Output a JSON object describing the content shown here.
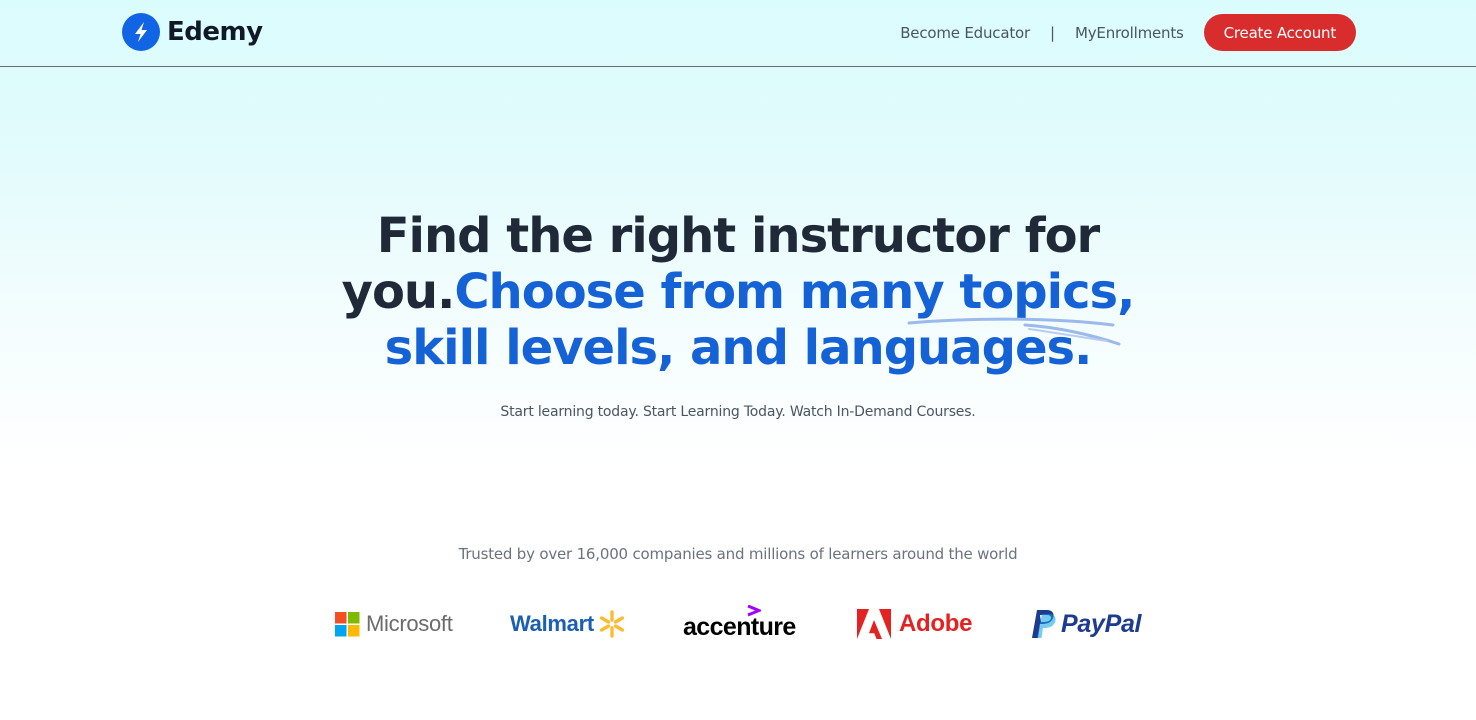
{
  "brand": {
    "name": "Edemy",
    "color": "#1164e4"
  },
  "nav": {
    "become_educator": "Become Educator",
    "separator": "|",
    "my_enrollments": "MyEnrollments",
    "create_account": "Create Account",
    "cta_color": "#d92d2d"
  },
  "hero": {
    "title_dark_1": "Find the right instructor for you.",
    "title_accent": "Choose from many topics, skill levels, and languages.",
    "accent_color": "#1562d6",
    "subtitle": "Start learning today. Start Learning Today. Watch In-Demand Courses."
  },
  "trusted": {
    "text": "Trusted by over 16,000 companies and millions of learners around the world",
    "companies": [
      "Microsoft",
      "Walmart",
      "accenture",
      "Adobe",
      "PayPal"
    ]
  }
}
